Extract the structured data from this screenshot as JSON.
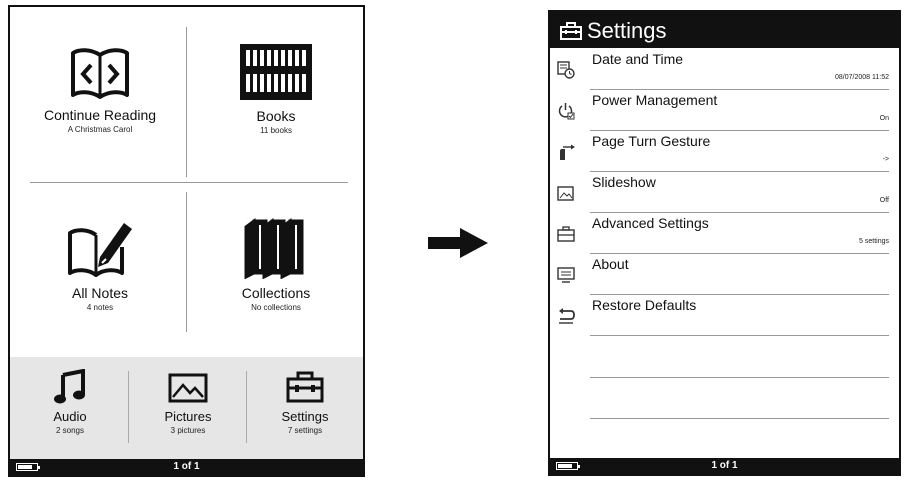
{
  "home": {
    "tiles": [
      {
        "title": "Continue Reading",
        "subtitle": "A Christmas Carol",
        "icon": "open-book-icon"
      },
      {
        "title": "Books",
        "subtitle": "11 books",
        "icon": "bookshelf-icon"
      },
      {
        "title": "All Notes",
        "subtitle": "4 notes",
        "icon": "notes-pen-icon"
      },
      {
        "title": "Collections",
        "subtitle": "No collections",
        "icon": "collections-icon"
      }
    ],
    "media": [
      {
        "title": "Audio",
        "subtitle": "2 songs",
        "icon": "music-note-icon"
      },
      {
        "title": "Pictures",
        "subtitle": "3 pictures",
        "icon": "picture-icon"
      },
      {
        "title": "Settings",
        "subtitle": "7 settings",
        "icon": "toolbox-icon"
      }
    ],
    "status": {
      "page": "1 of 1",
      "battery_icon": "battery-icon"
    }
  },
  "settings": {
    "title": "Settings",
    "items": [
      {
        "label": "Date and Time",
        "value": "08/07/2008 11:52",
        "icon": "calendar-clock-icon"
      },
      {
        "label": "Power Management",
        "value": "On",
        "icon": "power-icon"
      },
      {
        "label": "Page Turn Gesture",
        "value": "->",
        "icon": "gesture-icon"
      },
      {
        "label": "Slideshow",
        "value": "Off",
        "icon": "slideshow-icon"
      },
      {
        "label": "Advanced Settings",
        "value": "5 settings",
        "icon": "toolbox-icon"
      },
      {
        "label": "About",
        "value": "",
        "icon": "about-icon"
      },
      {
        "label": "Restore Defaults",
        "value": "",
        "icon": "restore-icon"
      }
    ],
    "status": {
      "page": "1 of 1",
      "battery_icon": "battery-icon"
    }
  },
  "arrow_icon": "right-arrow-icon"
}
